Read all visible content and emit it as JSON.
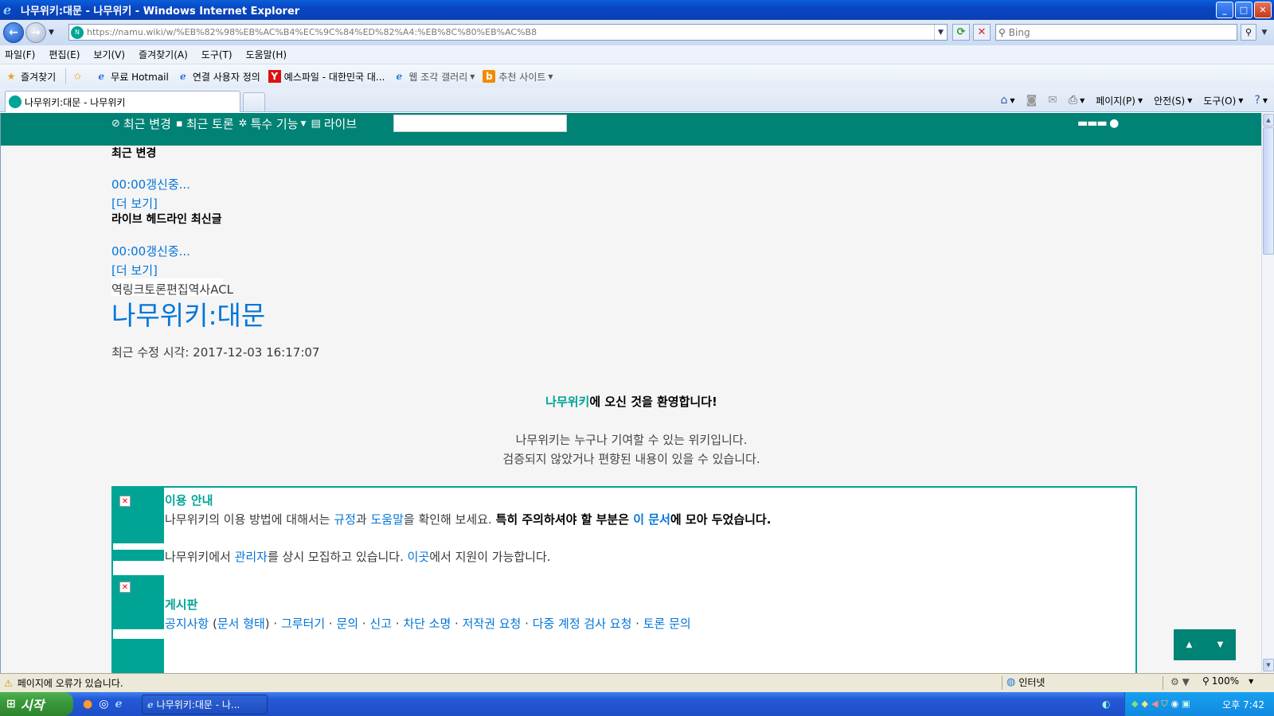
{
  "window": {
    "title": "나무위키:대문 - 나무위키 - Windows Internet Explorer",
    "min": "_",
    "max": "□",
    "close": "✕"
  },
  "address": {
    "url_host": "https://namu.wiki",
    "url_path": "/w/%EB%82%98%EB%AC%B4%EC%9C%84%ED%82%A4:%EB%8C%80%EB%AC%B8",
    "search_placeholder": "Bing"
  },
  "menu": [
    "파일(F)",
    "편집(E)",
    "보기(V)",
    "즐겨찾기(A)",
    "도구(T)",
    "도움말(H)"
  ],
  "favorites": {
    "label": "즐겨찾기",
    "items": [
      {
        "label": "무료 Hotmail",
        "icon": "ie-icon"
      },
      {
        "label": "연결 사용자 정의",
        "icon": "ie-icon"
      },
      {
        "label": "예스파일 - 대한민국 대...",
        "icon": "yes-icon"
      },
      {
        "label": "웹 조각 갤러리",
        "icon": "ie-icon"
      },
      {
        "label": "추천 사이트",
        "icon": "bing-icon"
      }
    ]
  },
  "tab": {
    "label": "나무위키:대문 - 나무위키"
  },
  "commands": {
    "page": "페이지(P)",
    "safety": "안전(S)",
    "tools": "도구(O)"
  },
  "wiki_nav": {
    "recent_changes": "최근 변경",
    "recent_discuss": "최근 토론",
    "special": "특수 기능",
    "live": "라이브"
  },
  "sidebar": {
    "recent_title": "최근 변경",
    "recent_loading": "00:00갱신중...",
    "more1": "[더 보기]",
    "live_title": "라이브 헤드라인 최신글",
    "live_loading": "00:00갱신중...",
    "more2": "[더 보기]"
  },
  "page": {
    "tools": "역링크토론편집역사ACL",
    "title": "나무위키:대문",
    "modified": "최근 수정 시각: 2017-12-03 16:17:07",
    "welcome_name": "나무위키",
    "welcome_rest": "에 오신 것을 환영합니다!",
    "desc1": "나무위키는 누구나 기여할 수 있는 위키입니다.",
    "desc2": "검증되지 않았거나 편향된 내용이 있을 수 있습니다."
  },
  "guide": {
    "usage_title": "이용 안내",
    "usage_p1": "나무위키의 이용 방법에 대해서는 ",
    "usage_rules": "규정",
    "usage_and": "과 ",
    "usage_help": "도움말",
    "usage_p2": "을 확인해 보세요. ",
    "usage_bold1": "특히 주의하셔야 할 부분은 ",
    "usage_doc": "이 문서",
    "usage_bold2": "에 모아 두었습니다.",
    "admin_p1": "나무위키에서 ",
    "admin_link": "관리자",
    "admin_p2": "를 상시 모집하고 있습니다. ",
    "admin_here": "이곳",
    "admin_p3": "에서 지원이 가능합니다.",
    "board_title": "게시판",
    "board_links": [
      "공지사항",
      "문서 형태",
      "그루터기",
      "문의",
      "신고",
      "차단 소명",
      "저작권 요청",
      "다중 계정 검사 요청",
      "토론 문의"
    ]
  },
  "status": {
    "message": "페이지에 오류가 있습니다.",
    "zone": "인터넷",
    "zoom": "100%"
  },
  "taskbar": {
    "start": "시작",
    "task": "나무위키:대문 - 나...",
    "clock": "오후 7:42"
  },
  "colors": {
    "namu_green": "#008275",
    "namu_accent": "#00a495",
    "link": "#0275d8"
  }
}
